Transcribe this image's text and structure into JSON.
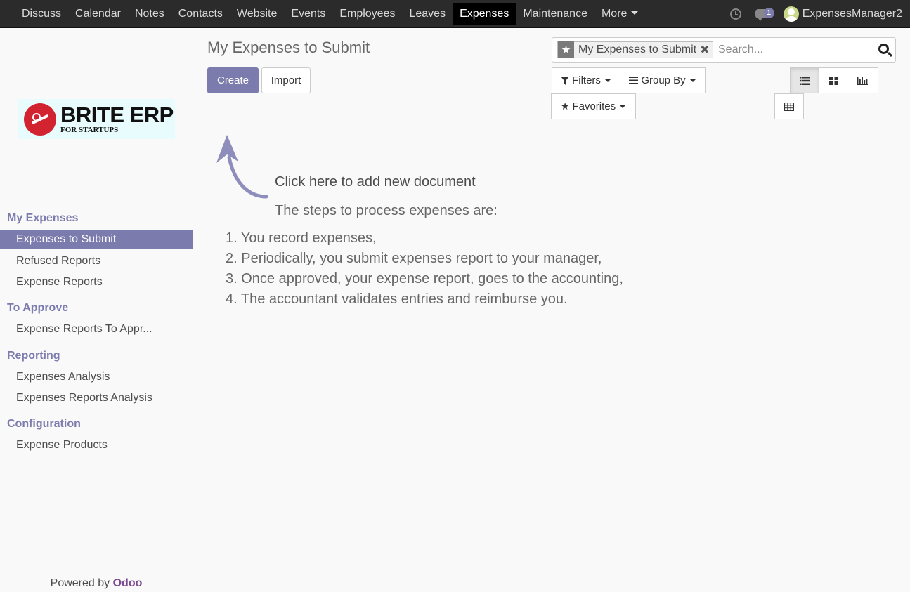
{
  "topbar": {
    "menu": [
      "Discuss",
      "Calendar",
      "Notes",
      "Contacts",
      "Website",
      "Events",
      "Employees",
      "Leaves",
      "Expenses",
      "Maintenance"
    ],
    "active": "Expenses",
    "more_label": "More",
    "chat_badge": "1",
    "user_name": "ExpensesManager2"
  },
  "logo": {
    "main": "BRITE ERP",
    "sub": "FOR STARTUPS"
  },
  "sidebar": {
    "sections": [
      {
        "title": "My Expenses",
        "items": [
          "Expenses to Submit",
          "Refused Reports",
          "Expense Reports"
        ]
      },
      {
        "title": "To Approve",
        "items": [
          "Expense Reports To Appr..."
        ]
      },
      {
        "title": "Reporting",
        "items": [
          "Expenses Analysis",
          "Expenses Reports Analysis"
        ]
      },
      {
        "title": "Configuration",
        "items": [
          "Expense Products"
        ]
      }
    ],
    "active_item": "Expenses to Submit",
    "powered_by": "Powered by",
    "powered_brand": "Odoo"
  },
  "control_panel": {
    "title": "My Expenses to Submit",
    "create_label": "Create",
    "import_label": "Import",
    "facet_label": "My Expenses to Submit",
    "search_placeholder": "Search...",
    "filters_label": "Filters",
    "groupby_label": "Group By",
    "favorites_label": "Favorites",
    "active_view": "list"
  },
  "help": {
    "title": "Click here to add new document",
    "subtitle": "The steps to process expenses are:",
    "steps": [
      "1. You record expenses,",
      "2. Periodically, you submit expenses report to your manager,",
      "3. Once approved, your expense report, goes to the accounting,",
      "4. The accountant validates entries and reimburse you."
    ]
  },
  "colors": {
    "accent": "#7c7bad",
    "topbar": "#2b2b2b",
    "brand_red": "#d22331"
  }
}
